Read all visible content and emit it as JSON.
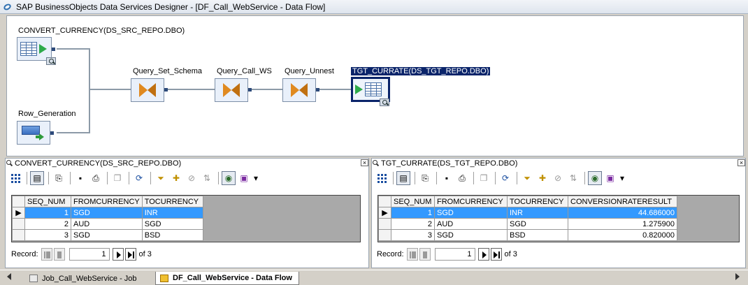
{
  "window": {
    "title": "SAP BusinessObjects Data Services Designer - [DF_Call_WebService - Data Flow]"
  },
  "canvas": {
    "nodes": {
      "source": "CONVERT_CURRENCY(DS_SRC_REPO.DBO)",
      "rowgen": "Row_Generation",
      "q1": "Query_Set_Schema",
      "q2": "Query_Call_WS",
      "q3": "Query_Unnest",
      "target": "TGT_CURRATE(DS_TGT_REPO.DBO)"
    }
  },
  "left_panel": {
    "title": "CONVERT_CURRENCY(DS_SRC_REPO.DBO)",
    "columns": [
      "SEQ_NUM",
      "FROMCURRENCY",
      "TOCURRENCY"
    ],
    "rows": [
      {
        "seq": "1",
        "from": "SGD",
        "to": "INR"
      },
      {
        "seq": "2",
        "from": "AUD",
        "to": "SGD"
      },
      {
        "seq": "3",
        "from": "SGD",
        "to": "BSD"
      }
    ],
    "record_label": "Record:",
    "record_value": "1",
    "record_total": "of 3"
  },
  "right_panel": {
    "title": "TGT_CURRATE(DS_TGT_REPO.DBO)",
    "columns": [
      "SEQ_NUM",
      "FROMCURRENCY",
      "TOCURRENCY",
      "CONVERSIONRATERESULT"
    ],
    "rows": [
      {
        "seq": "1",
        "from": "SGD",
        "to": "INR",
        "rate": "44.686000"
      },
      {
        "seq": "2",
        "from": "AUD",
        "to": "SGD",
        "rate": "1.275900"
      },
      {
        "seq": "3",
        "from": "SGD",
        "to": "BSD",
        "rate": "0.820000"
      }
    ],
    "record_label": "Record:",
    "record_value": "1",
    "record_total": "of 3"
  },
  "tabs": [
    {
      "label": "Job_Call_WebService - Job",
      "active": false
    },
    {
      "label": "DF_Call_WebService - Data Flow",
      "active": true
    }
  ],
  "colors": {
    "selection": "#0a246a",
    "row_highlight": "#3399ff"
  }
}
